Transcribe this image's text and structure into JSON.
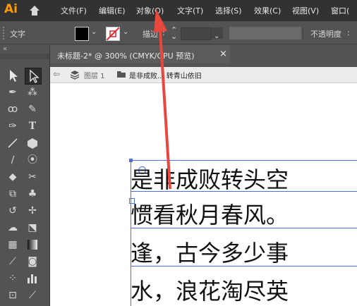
{
  "menubar": {
    "logo": "Ai",
    "items": [
      "文件(F)",
      "编辑(E)",
      "对象(O)",
      "文字(T)",
      "选择(S)",
      "效果(C)",
      "视图(V)",
      "窗口("
    ]
  },
  "control_bar": {
    "tool_label": "文字",
    "stroke_label": "描边",
    "opacity_label": "不透明度"
  },
  "document": {
    "tab_title": "未标题-2* @ 300% (CMYK/GPU 预览)",
    "close_symbol": "×",
    "breadcrumb_layer": "图层 1",
    "breadcrumb_group": "是非成败... 转青山依旧"
  },
  "text_content": [
    "是非成败转头空",
    "惯看秋月春风。",
    "逢，古今多少事",
    "水，浪花淘尽英"
  ],
  "colors": {
    "accent": "#4d6fe0",
    "arrow": "#e8473e",
    "logo": "#ff9a00"
  }
}
